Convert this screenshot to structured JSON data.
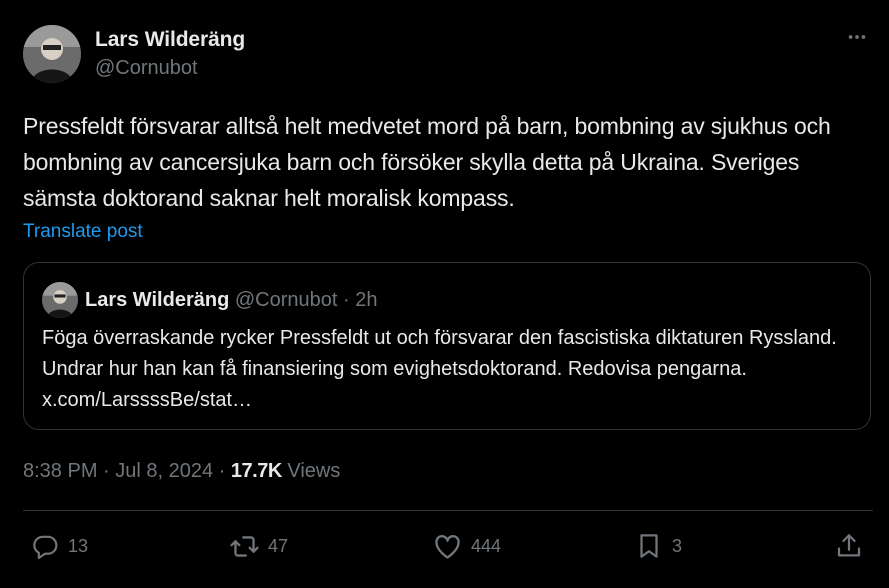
{
  "author": {
    "name": "Lars Wilderäng",
    "handle": "@Cornubot"
  },
  "post": {
    "text": "Pressfeldt försvarar alltså helt medvetet mord på barn, bombning av sjukhus och bombning av cancersjuka barn och försöker skylla detta på Ukraina. Sveriges sämsta doktorand saknar helt moralisk kompass.",
    "translate_label": "Translate post"
  },
  "quote": {
    "name": "Lars Wilderäng",
    "handle": "@Cornubot",
    "separator": " · ",
    "time": "2h",
    "text": "Föga överraskande rycker Pressfeldt ut och försvarar den fascistiska diktaturen Ryssland. Undrar hur han kan få finansiering som evighetsdoktorand. Redovisa pengarna. x.com/LarssssBe/stat…"
  },
  "meta": {
    "time": "8:38 PM",
    "date": "Jul 8, 2024",
    "separator": " · ",
    "views_count": "17.7K",
    "views_label": " Views"
  },
  "actions": {
    "replies": "13",
    "reposts": "47",
    "likes": "444",
    "bookmarks": "3"
  },
  "icons": {
    "more": "more-horizontal-icon",
    "reply": "reply-icon",
    "repost": "repost-icon",
    "like": "like-icon",
    "bookmark": "bookmark-icon",
    "share": "share-icon"
  },
  "colors": {
    "background": "#000000",
    "text": "#e7e9ea",
    "secondary": "#71767b",
    "link": "#1d9bf0",
    "border": "#2f3336"
  }
}
